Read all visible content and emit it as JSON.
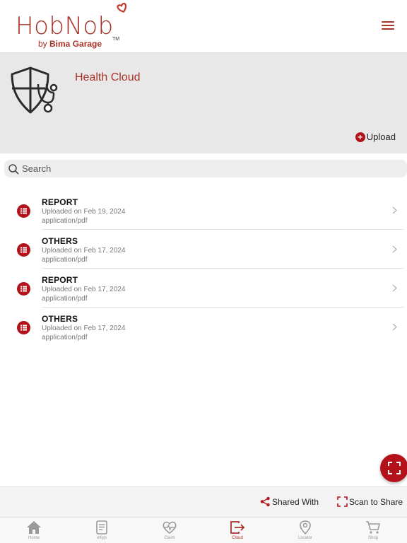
{
  "app": {
    "logo_text": "HobNob",
    "logo_sub_prefix": "by ",
    "logo_sub_brand": "Bima Garage",
    "logo_tm": "TM"
  },
  "banner": {
    "title": "Health Cloud",
    "upload_label": "Upload"
  },
  "search": {
    "placeholder": "Search"
  },
  "documents": [
    {
      "title": "REPORT",
      "date": "Uploaded on Feb 19, 2024",
      "type": "application/pdf"
    },
    {
      "title": "OTHERS",
      "date": "Uploaded on Feb 17, 2024",
      "type": "application/pdf"
    },
    {
      "title": "REPORT",
      "date": "Uploaded on Feb 17, 2024",
      "type": "application/pdf"
    },
    {
      "title": "OTHERS",
      "date": "Uploaded on Feb 17, 2024",
      "type": "application/pdf"
    }
  ],
  "actions": {
    "shared_with": "Shared With",
    "scan_to_share": "Scan to Share"
  },
  "tabs": [
    {
      "label": "Home",
      "icon": "home-icon"
    },
    {
      "label": "eKyp",
      "icon": "document-icon"
    },
    {
      "label": "Claim",
      "icon": "heartbeat-icon"
    },
    {
      "label": "Cloud",
      "icon": "cloud-export-icon"
    },
    {
      "label": "Locator",
      "icon": "location-pin-icon"
    },
    {
      "label": "Shop",
      "icon": "cart-icon"
    }
  ],
  "active_tab": "Cloud",
  "colors": {
    "brand": "#a8322a",
    "accent": "#b3121b",
    "banner_bg": "#e8e8e8"
  }
}
